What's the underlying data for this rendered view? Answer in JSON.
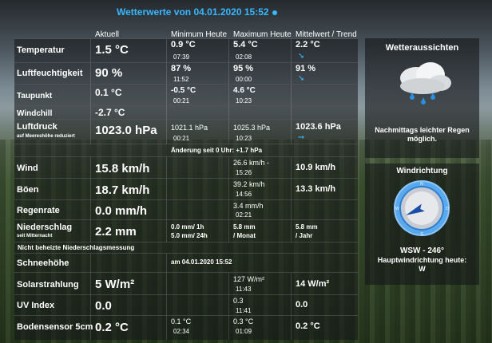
{
  "title": "Wetterwerte von 04.01.2020 15:52",
  "headers": {
    "actual": "Aktuell",
    "min": "Minimum Heute",
    "max": "Maximum Heute",
    "avg": "Mittelwert / Trend"
  },
  "rows": {
    "temp": {
      "label": "Temperatur",
      "value": "1.5 °C",
      "min": "0.9 °C",
      "min_time": "07:39",
      "max": "5.4 °C",
      "max_time": "02:08",
      "avg": "2.2 °C",
      "trend": "down-right-arrow"
    },
    "humidity": {
      "label": "Luftfeuchtigkeit",
      "value": "90 %",
      "min": "87 %",
      "min_time": "11:52",
      "max": "95 %",
      "max_time": "00:00",
      "avg": "91 %",
      "trend": "down-right-arrow"
    },
    "dewpoint": {
      "label": "Taupunkt",
      "value": "0.1 °C",
      "min": "-0.5 °C",
      "min_time": "00:21",
      "max": "4.6 °C",
      "max_time": "10:23"
    },
    "windchill": {
      "label": "Windchill",
      "value": "-2.7 °C"
    },
    "pressure": {
      "label": "Luftdruck",
      "sublabel": "auf Meereshöhe reduziert",
      "value": "1023.0 hPa",
      "min": "1021.1 hPa",
      "min_time": "00:21",
      "max": "1025.3 hPa",
      "max_time": "10:23",
      "avg": "1023.6 hPa",
      "trend": "right-arrow",
      "change": "Änderung seit 0 Uhr: +1.7 hPa"
    },
    "wind": {
      "label": "Wind",
      "value": "15.8 km/h",
      "max": "26.6 km/h -",
      "max_time": "15:26",
      "avg": "10.9 km/h"
    },
    "gusts": {
      "label": "Böen",
      "value": "18.7 km/h",
      "max": "39.2 km/h",
      "max_time": "14:56",
      "avg": "13.3 km/h"
    },
    "rainrate": {
      "label": "Regenrate",
      "value": "0.0 mm/h",
      "max": "3.4 mm/h",
      "max_time": "02:21"
    },
    "rain": {
      "label": "Niederschlag",
      "sublabel": "seit Mitternacht",
      "value": "2.2 mm",
      "hour": "0.0 mm/ 1h",
      "day": "5.0 mm/ 24h",
      "month1": "5.8 mm",
      "month2": "/ Monat",
      "year1": "5.8 mm",
      "year2": "/ Jahr"
    },
    "note": "Nicht beheizte Niederschlagsmessung",
    "snow": {
      "label": "Schneehöhe",
      "date": "am 04.01.2020 15:52"
    },
    "solar": {
      "label": "Solarstrahlung",
      "value": "5 W/m²",
      "max": "127 W/m²",
      "max_time": "11:43",
      "avg": "14 W/m²"
    },
    "uv": {
      "label": "UV Index",
      "value": "0.0",
      "max": "0.3",
      "max_time": "11:41",
      "avg": "0.0"
    },
    "soil": {
      "label": "Bodensensor 5cm",
      "value": "0.2 °C",
      "min": "0.1 °C",
      "min_time": "02:34",
      "max": "0.3 °C",
      "max_time": "01:09",
      "avg": "0.2 °C"
    }
  },
  "outlook": {
    "title": "Wetteraussichten",
    "icon": "rain-cloud-icon",
    "text1": "Nachmittags leichter Regen",
    "text2": "möglich."
  },
  "winddir": {
    "title": "Windrichtung",
    "value": "WSW - 246°",
    "label": "Hauptwindrichtung heute:",
    "main": "W",
    "degrees": 246
  },
  "colors": {
    "accent": "#38b8ff"
  }
}
